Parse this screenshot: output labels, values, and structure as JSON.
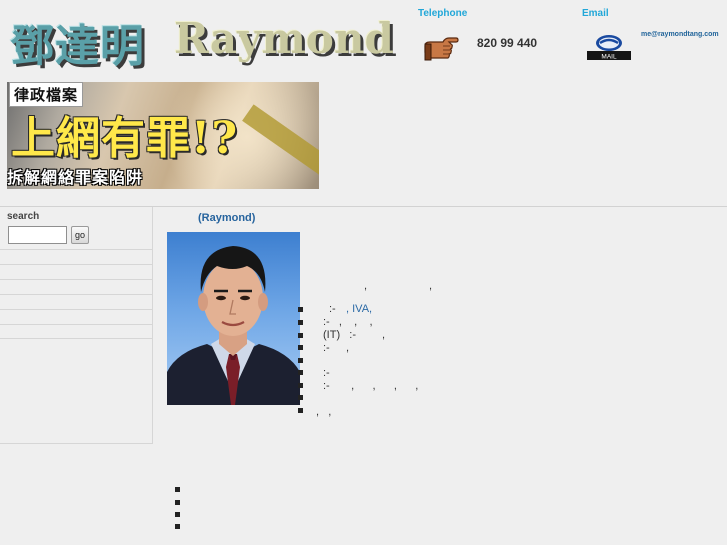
{
  "header": {
    "logo_cn": "鄧達明",
    "logo_en": "Raymond",
    "telephone_label": "Telephone",
    "phone_number": "820 99 440",
    "email_label": "Email",
    "email_address": "me@raymondtang.com",
    "mail_icon_text": "MAIL",
    "icons": [
      "pointing-hand-icon",
      "email-icon"
    ]
  },
  "banner": {
    "top_caption": "律政檔案",
    "headline": "上網有罪!?",
    "bottom_caption": "拆解網絡罪案陷阱"
  },
  "sidebar": {
    "search_label": "search",
    "search_placeholder": "",
    "go_label": "go"
  },
  "main": {
    "profile_title": "(Raymond)",
    "fragments": {
      "f1": ",",
      "f2": ",",
      "f3": ":-",
      "f4": ", IVA,",
      "f5": ":-   ,    ,    ,",
      "f6": "(IT)   :-",
      "f7": ",",
      "f8": ":-",
      "f9": ",",
      "f10": ":-",
      "f11": ":-       ,      ,      ,      ,",
      "f12": ",   ,"
    }
  },
  "colors": {
    "accent_cyan": "#21a7d8",
    "link_blue": "#27649e",
    "background": "#efefef",
    "banner_yellow": "#ffe84a"
  }
}
